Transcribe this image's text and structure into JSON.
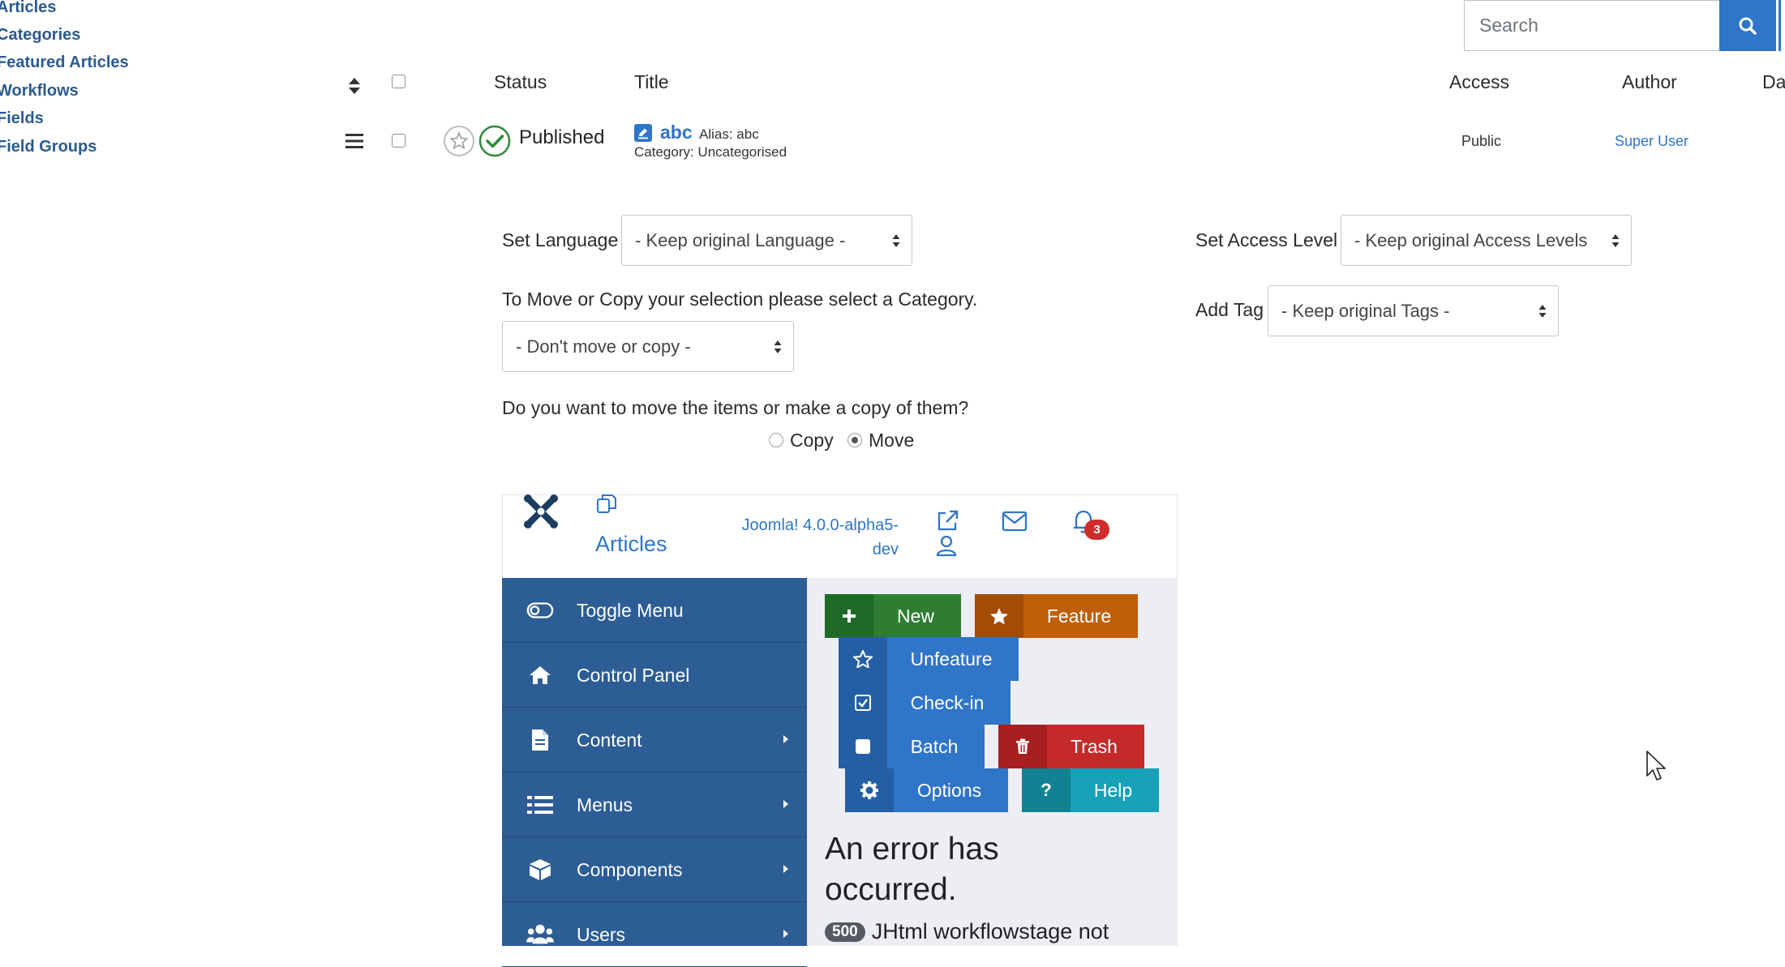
{
  "left_menu": [
    "Articles",
    "Categories",
    "Featured Articles",
    "Workflows",
    "Fields",
    "Field Groups"
  ],
  "search": {
    "placeholder": "Search"
  },
  "table": {
    "headers": {
      "status": "Status",
      "title": "Title",
      "access": "Access",
      "author": "Author",
      "date": "Da"
    },
    "row": {
      "status": "Published",
      "title": "abc",
      "alias": "Alias: abc",
      "category": "Category: Uncategorised",
      "access": "Public",
      "author": "Super User"
    }
  },
  "batch": {
    "set_language_label": "Set Language",
    "language_value": "- Keep original Language -",
    "set_access_label": "Set Access Level",
    "access_value": "- Keep original Access Levels",
    "add_tag_label": "Add Tag",
    "tag_value": "- Keep original Tags -",
    "move_copy_prompt": "To Move or Copy your selection please select a Category.",
    "category_value": "- Don't move or copy -",
    "move_question": "Do you want to move the items or make a copy of them?",
    "copy_label": "Copy",
    "move_label": "Move",
    "selected_option": "Move"
  },
  "embed": {
    "header": {
      "page_title": "Articles",
      "version_line1": "Joomla! 4.0.0-alpha5-",
      "version_line2": "dev",
      "notification_count": "3"
    },
    "sidebar": [
      "Toggle Menu",
      "Control Panel",
      "Content",
      "Menus",
      "Components",
      "Users"
    ],
    "toolbar": {
      "new": "New",
      "feature": "Feature",
      "unfeature": "Unfeature",
      "checkin": "Check-in",
      "batch": "Batch",
      "trash": "Trash",
      "options": "Options",
      "help": "Help"
    },
    "error": {
      "title_line1": "An error has",
      "title_line2": "occurred.",
      "code": "500",
      "message": "JHtml workflowstage not"
    }
  },
  "colors": {
    "link": "#2a5a8f",
    "primary": "#2f75c8",
    "sidebar": "#2c5d95",
    "success": "#2f7d32",
    "feature": "#c15e0a",
    "danger": "#c52a2a",
    "help": "#17a2b8",
    "published": "#2f8a3a"
  }
}
